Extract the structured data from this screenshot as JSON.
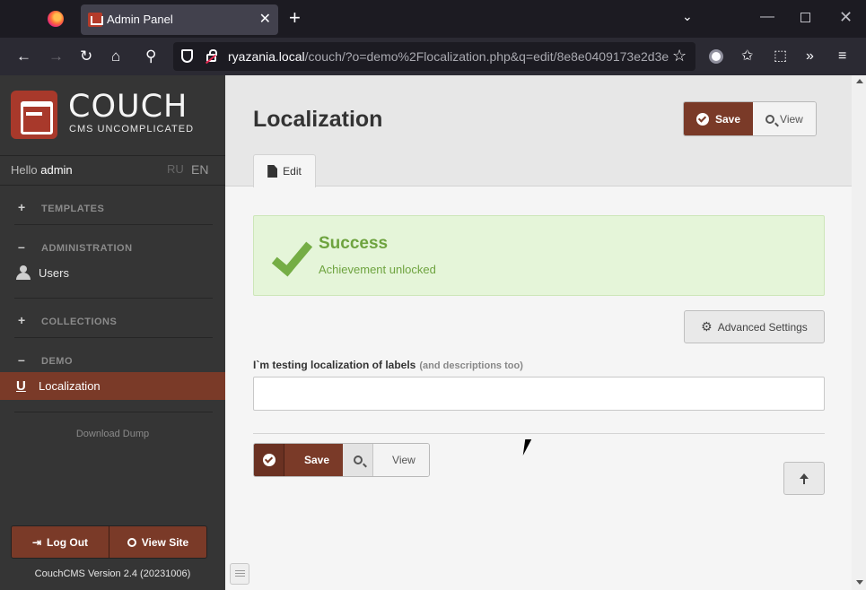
{
  "browser": {
    "tab_title": "Admin Panel",
    "url_host": "ryazania.local",
    "url_rest": "/couch/?o=demo%2Flocalization.php&q=edit/8e8e0409173e2d3e",
    "icons": [
      "firefox-icon",
      "close-icon",
      "plus-icon",
      "chevron-down-icon",
      "back-icon",
      "forward-icon",
      "reload-icon",
      "home-icon",
      "search-icon",
      "shield-icon",
      "lock-icon",
      "star-icon",
      "extension-icon",
      "menu-icon"
    ]
  },
  "sidebar": {
    "logo_title": "COUCH",
    "logo_sub": "CMS UNCOMPLICATED",
    "hello": "Hello",
    "user": "admin",
    "lang_ru": "RU",
    "lang_en": "EN",
    "groups": [
      {
        "symbol": "+",
        "label": "TEMPLATES"
      },
      {
        "symbol": "–",
        "label": "ADMINISTRATION"
      },
      {
        "symbol": "+",
        "label": "COLLECTIONS"
      },
      {
        "symbol": "–",
        "label": "DEMO"
      }
    ],
    "users_label": "Users",
    "localization_icon": "U",
    "localization_label": "Localization",
    "download_dump": "Download Dump",
    "logout_label": "Log Out",
    "viewsite_label": "View Site",
    "version": "CouchCMS Version 2.4 (20231006)"
  },
  "main": {
    "title": "Localization",
    "save_label": "Save",
    "view_label": "View",
    "edit_tab": "Edit",
    "alert_title": "Success",
    "alert_msg": "Achievement unlocked",
    "advanced_label": "Advanced Settings",
    "field_label": "I`m testing localization of labels",
    "field_desc": "(and descriptions too)",
    "field_value": ""
  },
  "colors": {
    "accent": "#7a3a28",
    "sidebar_bg": "#353535",
    "success": "#6ea33f"
  }
}
